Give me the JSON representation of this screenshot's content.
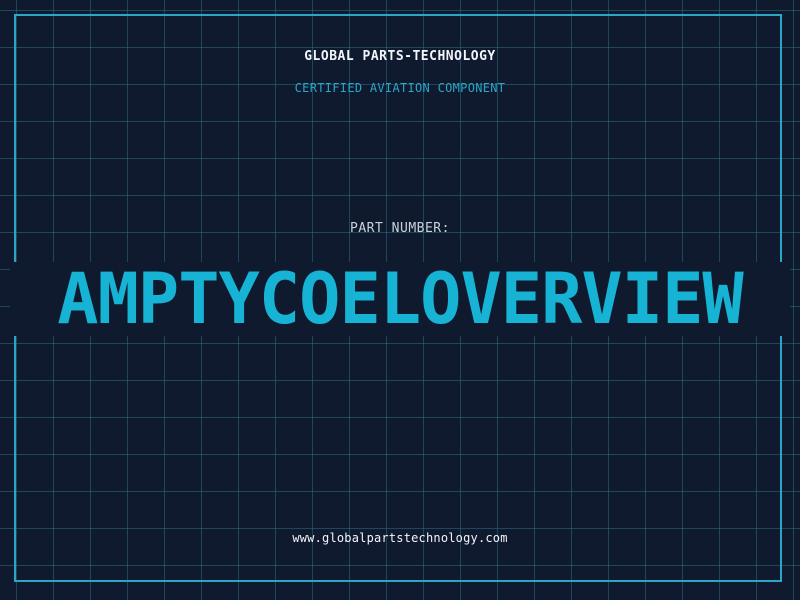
{
  "header": {
    "company": "GLOBAL PARTS-TECHNOLOGY",
    "tagline": "CERTIFIED AVIATION COMPONENT"
  },
  "part": {
    "label": "PART NUMBER:",
    "number": "AMPTYCOELOVERVIEW"
  },
  "footer": {
    "website": "www.globalpartstechnology.com"
  },
  "colors": {
    "background": "#101a2e",
    "grid": "#286e82",
    "accent": "#2aa6c8",
    "part_number": "#16b3d4",
    "text": "#f2f6fb"
  }
}
